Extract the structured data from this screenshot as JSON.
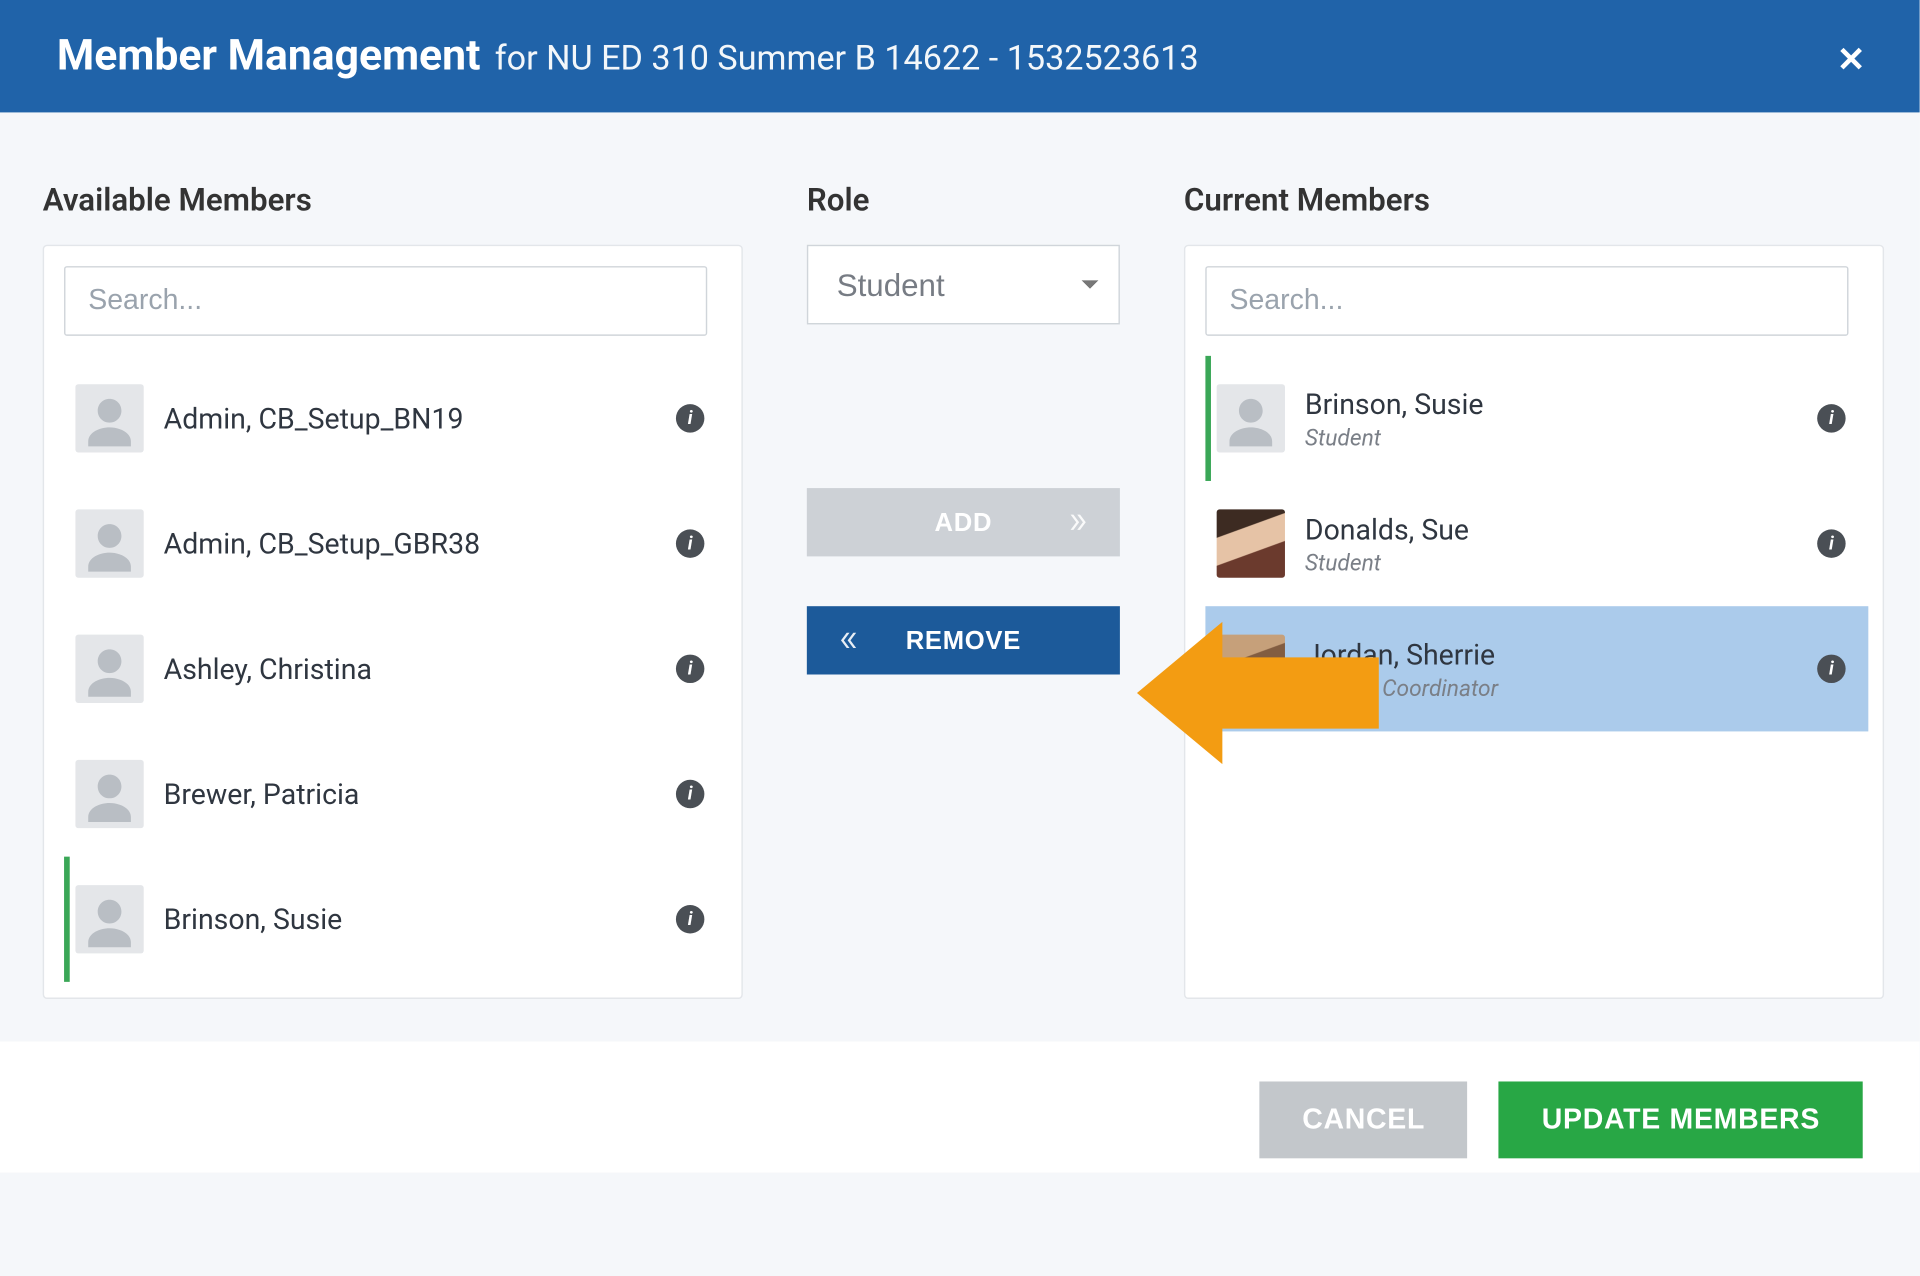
{
  "header": {
    "title": "Member Management",
    "subtitle": "for NU ED 310 Summer B 14622 - 1532523613"
  },
  "labels": {
    "available": "Available Members",
    "role": "Role",
    "current": "Current Members"
  },
  "search": {
    "placeholder_left": "Search...",
    "placeholder_right": "Search..."
  },
  "role_select": {
    "selected": "Student"
  },
  "buttons": {
    "add": "ADD",
    "remove": "REMOVE",
    "cancel": "CANCEL",
    "update": "UPDATE MEMBERS"
  },
  "available_members": [
    {
      "name": "Admin, CB_Setup_BN19",
      "greenStripe": false
    },
    {
      "name": "Admin, CB_Setup_GBR38",
      "greenStripe": false
    },
    {
      "name": "Ashley, Christina",
      "greenStripe": false
    },
    {
      "name": "Brewer, Patricia",
      "greenStripe": false
    },
    {
      "name": "Brinson, Susie",
      "greenStripe": true
    }
  ],
  "current_members": [
    {
      "name": "Brinson, Susie",
      "role": "Student",
      "greenStripe": true,
      "selected": false,
      "avatar": "default"
    },
    {
      "name": "Donalds, Sue",
      "role": "Student",
      "greenStripe": false,
      "selected": false,
      "avatar": "photo1"
    },
    {
      "name": "Jordan, Sherrie",
      "role": "Clinical Coordinator",
      "greenStripe": false,
      "selected": true,
      "avatar": "photo2"
    }
  ],
  "colors": {
    "primary": "#2063a9",
    "success": "#28a745",
    "annotation": "#f39c12"
  }
}
